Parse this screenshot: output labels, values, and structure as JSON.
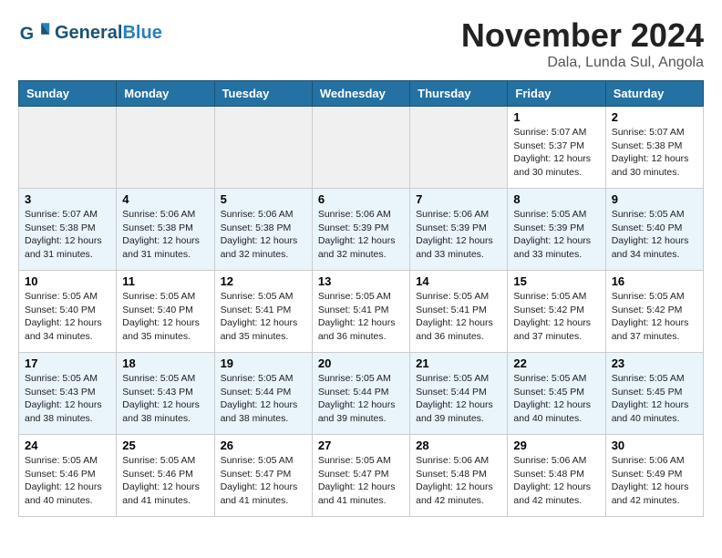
{
  "header": {
    "logo_general": "General",
    "logo_blue": "Blue",
    "month_title": "November 2024",
    "location": "Dala, Lunda Sul, Angola"
  },
  "weekdays": [
    "Sunday",
    "Monday",
    "Tuesday",
    "Wednesday",
    "Thursday",
    "Friday",
    "Saturday"
  ],
  "weeks": [
    [
      {
        "day": "",
        "empty": true
      },
      {
        "day": "",
        "empty": true
      },
      {
        "day": "",
        "empty": true
      },
      {
        "day": "",
        "empty": true
      },
      {
        "day": "",
        "empty": true
      },
      {
        "day": "1",
        "sunrise": "5:07 AM",
        "sunset": "5:37 PM",
        "daylight": "12 hours and 30 minutes."
      },
      {
        "day": "2",
        "sunrise": "5:07 AM",
        "sunset": "5:38 PM",
        "daylight": "12 hours and 30 minutes."
      }
    ],
    [
      {
        "day": "3",
        "sunrise": "5:07 AM",
        "sunset": "5:38 PM",
        "daylight": "12 hours and 31 minutes."
      },
      {
        "day": "4",
        "sunrise": "5:06 AM",
        "sunset": "5:38 PM",
        "daylight": "12 hours and 31 minutes."
      },
      {
        "day": "5",
        "sunrise": "5:06 AM",
        "sunset": "5:38 PM",
        "daylight": "12 hours and 32 minutes."
      },
      {
        "day": "6",
        "sunrise": "5:06 AM",
        "sunset": "5:39 PM",
        "daylight": "12 hours and 32 minutes."
      },
      {
        "day": "7",
        "sunrise": "5:06 AM",
        "sunset": "5:39 PM",
        "daylight": "12 hours and 33 minutes."
      },
      {
        "day": "8",
        "sunrise": "5:05 AM",
        "sunset": "5:39 PM",
        "daylight": "12 hours and 33 minutes."
      },
      {
        "day": "9",
        "sunrise": "5:05 AM",
        "sunset": "5:40 PM",
        "daylight": "12 hours and 34 minutes."
      }
    ],
    [
      {
        "day": "10",
        "sunrise": "5:05 AM",
        "sunset": "5:40 PM",
        "daylight": "12 hours and 34 minutes."
      },
      {
        "day": "11",
        "sunrise": "5:05 AM",
        "sunset": "5:40 PM",
        "daylight": "12 hours and 35 minutes."
      },
      {
        "day": "12",
        "sunrise": "5:05 AM",
        "sunset": "5:41 PM",
        "daylight": "12 hours and 35 minutes."
      },
      {
        "day": "13",
        "sunrise": "5:05 AM",
        "sunset": "5:41 PM",
        "daylight": "12 hours and 36 minutes."
      },
      {
        "day": "14",
        "sunrise": "5:05 AM",
        "sunset": "5:41 PM",
        "daylight": "12 hours and 36 minutes."
      },
      {
        "day": "15",
        "sunrise": "5:05 AM",
        "sunset": "5:42 PM",
        "daylight": "12 hours and 37 minutes."
      },
      {
        "day": "16",
        "sunrise": "5:05 AM",
        "sunset": "5:42 PM",
        "daylight": "12 hours and 37 minutes."
      }
    ],
    [
      {
        "day": "17",
        "sunrise": "5:05 AM",
        "sunset": "5:43 PM",
        "daylight": "12 hours and 38 minutes."
      },
      {
        "day": "18",
        "sunrise": "5:05 AM",
        "sunset": "5:43 PM",
        "daylight": "12 hours and 38 minutes."
      },
      {
        "day": "19",
        "sunrise": "5:05 AM",
        "sunset": "5:44 PM",
        "daylight": "12 hours and 38 minutes."
      },
      {
        "day": "20",
        "sunrise": "5:05 AM",
        "sunset": "5:44 PM",
        "daylight": "12 hours and 39 minutes."
      },
      {
        "day": "21",
        "sunrise": "5:05 AM",
        "sunset": "5:44 PM",
        "daylight": "12 hours and 39 minutes."
      },
      {
        "day": "22",
        "sunrise": "5:05 AM",
        "sunset": "5:45 PM",
        "daylight": "12 hours and 40 minutes."
      },
      {
        "day": "23",
        "sunrise": "5:05 AM",
        "sunset": "5:45 PM",
        "daylight": "12 hours and 40 minutes."
      }
    ],
    [
      {
        "day": "24",
        "sunrise": "5:05 AM",
        "sunset": "5:46 PM",
        "daylight": "12 hours and 40 minutes."
      },
      {
        "day": "25",
        "sunrise": "5:05 AM",
        "sunset": "5:46 PM",
        "daylight": "12 hours and 41 minutes."
      },
      {
        "day": "26",
        "sunrise": "5:05 AM",
        "sunset": "5:47 PM",
        "daylight": "12 hours and 41 minutes."
      },
      {
        "day": "27",
        "sunrise": "5:05 AM",
        "sunset": "5:47 PM",
        "daylight": "12 hours and 41 minutes."
      },
      {
        "day": "28",
        "sunrise": "5:06 AM",
        "sunset": "5:48 PM",
        "daylight": "12 hours and 42 minutes."
      },
      {
        "day": "29",
        "sunrise": "5:06 AM",
        "sunset": "5:48 PM",
        "daylight": "12 hours and 42 minutes."
      },
      {
        "day": "30",
        "sunrise": "5:06 AM",
        "sunset": "5:49 PM",
        "daylight": "12 hours and 42 minutes."
      }
    ]
  ]
}
